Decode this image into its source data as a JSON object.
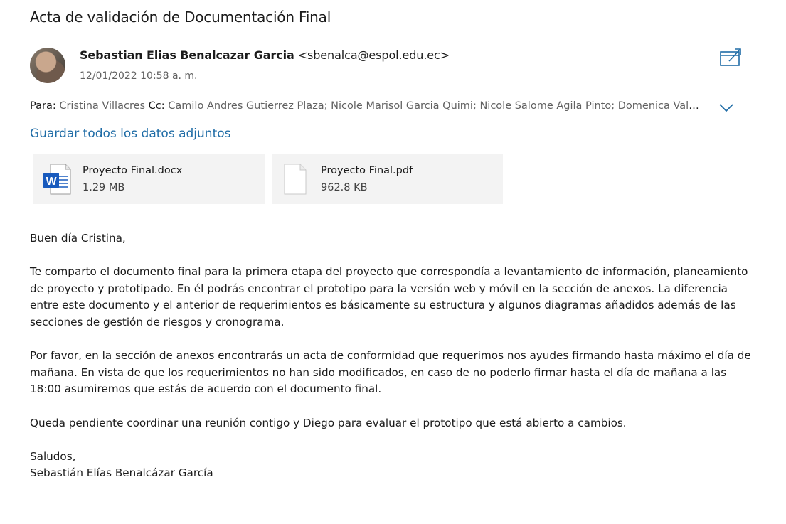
{
  "email": {
    "subject": "Acta de validación de Documentación Final",
    "sender_name": "Sebastian Elias Benalcazar Garcia",
    "sender_email": "<sbenalca@espol.edu.ec>",
    "date": "12/01/2022 10:58 a. m.",
    "to_label": "Para:",
    "to": "Cristina Villacres",
    "cc_label": "Cc:",
    "cc": "Camilo Andres Gutierrez Plaza; Nicole Marisol Garcia Quimi; Nicole Salome Agila Pinto; Domenica Valeria..."
  },
  "attachments_bar": {
    "save_all_label": "Guardar todos los datos adjuntos"
  },
  "attachments": [
    {
      "name": "Proyecto Final.docx",
      "size": "1.29 MB",
      "icon": "word-document-icon"
    },
    {
      "name": "Proyecto Final.pdf",
      "size": "962.8 KB",
      "icon": "pdf-document-icon"
    }
  ],
  "body": {
    "greeting": "Buen día Cristina,",
    "p1": "Te comparto el documento final para la primera etapa del proyecto que correspondía a levantamiento de información, planeamiento de proyecto y prototipado. En él podrás encontrar el prototipo para la versión web y móvil en la sección de anexos. La diferencia entre este documento y el anterior de requerimientos es básicamente su estructura y algunos diagramas añadidos además de las secciones de gestión de riesgos y cronograma.",
    "p2": "Por favor, en la sección de anexos encontrarás un acta de conformidad que requerimos nos ayudes firmando hasta máximo el día de mañana. En vista de que los requerimientos no han sido modificados, en caso de no poderlo firmar hasta el día de mañana a las 18:00 asumiremos que estás de acuerdo con el documento final.",
    "p3": "Queda pendiente coordinar una reunión contigo y Diego para evaluar el prototipo que está abierto a cambios.",
    "closing": "Saludos,",
    "signature": "Sebastián Elías Benalcázar García"
  },
  "colors": {
    "accent": "#1f6ca6",
    "secondary_text": "#616161",
    "attachment_bg": "#f3f3f3",
    "word_blue": "#185abd"
  }
}
